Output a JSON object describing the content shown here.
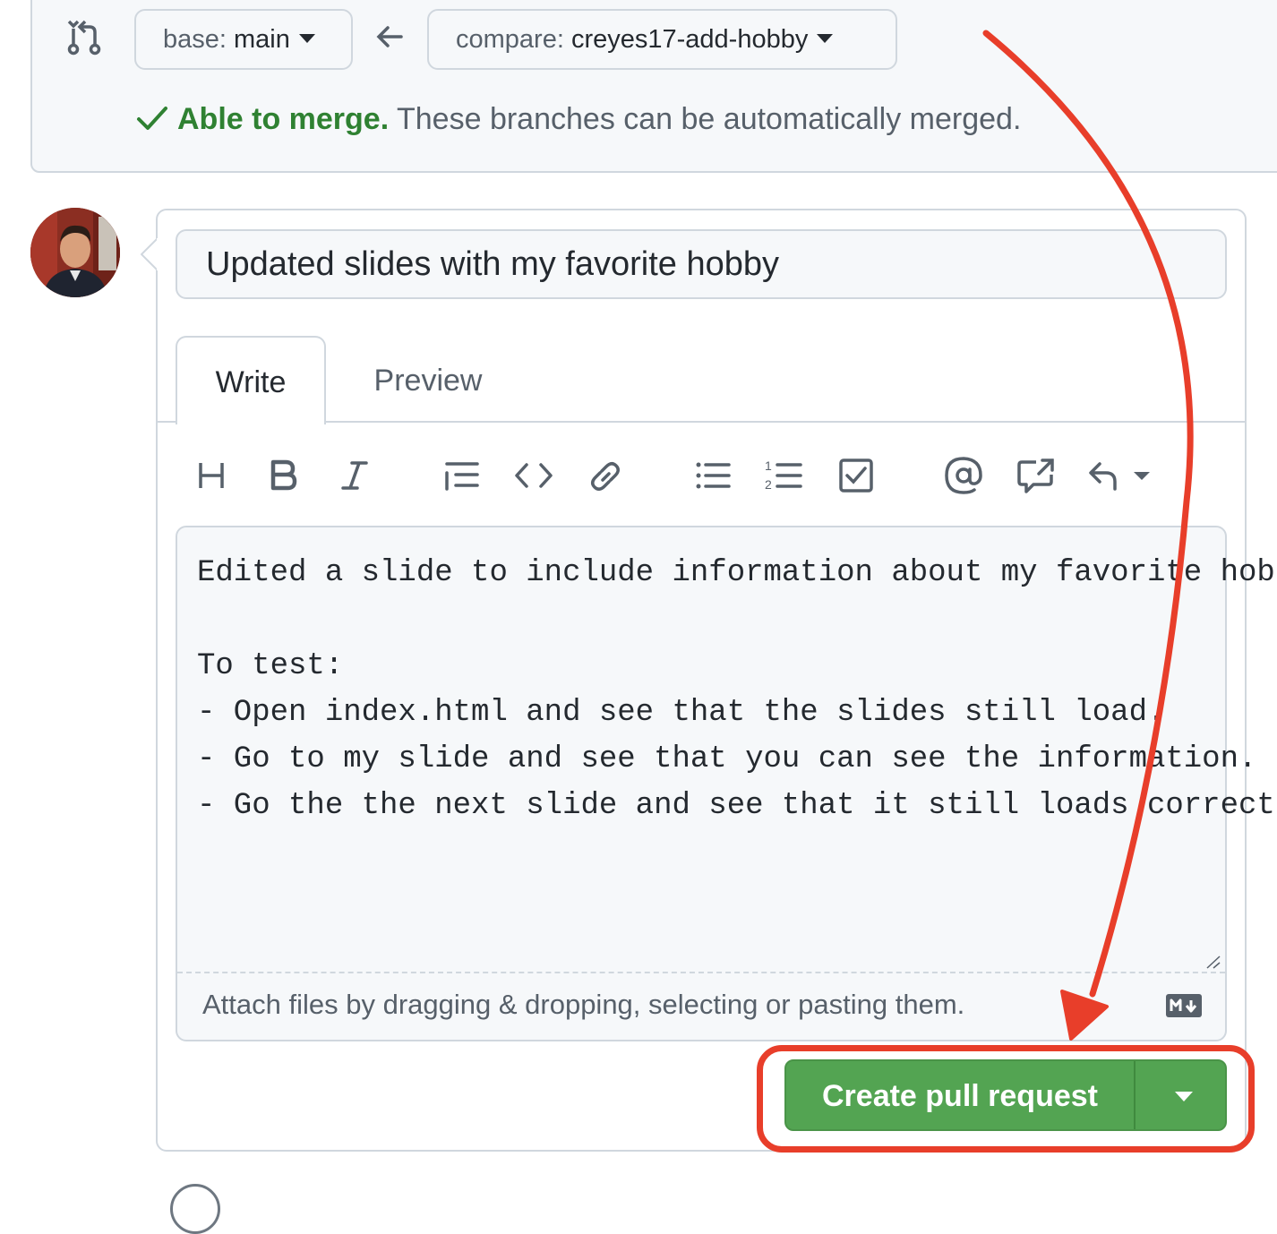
{
  "compare": {
    "base_prefix": "base: ",
    "base_branch": "main",
    "compare_prefix": "compare: ",
    "compare_branch": "creyes17-add-hobby",
    "merge_ok": "Able to merge.",
    "merge_msg": " These branches can be automatically merged."
  },
  "form": {
    "title_value": "Updated slides with my favorite hobby",
    "tabs": [
      {
        "label": "Write",
        "active": true
      },
      {
        "label": "Preview",
        "active": false
      }
    ],
    "toolbar_icons": [
      "heading-icon",
      "bold-icon",
      "italic-icon",
      "quote-icon",
      "code-icon",
      "link-icon",
      "bulleted-list-icon",
      "numbered-list-icon",
      "task-list-icon",
      "mention-icon",
      "cross-reference-icon",
      "saved-reply-icon"
    ],
    "body_value": "Edited a slide to include information about my favorite hobby.\n\nTo test:\n- Open index.html and see that the slides still load.\n- Go to my slide and see that you can see the information.\n- Go the the next slide and see that it still loads correctly",
    "attach_hint": "Attach files by dragging & dropping, selecting or pasting them.",
    "markdown_badge": "markdown-icon"
  },
  "actions": {
    "create_label": "Create pull request"
  },
  "colors": {
    "success_green": "#2f8132",
    "button_green": "#53a452",
    "annotation_red": "#e83e2a"
  }
}
